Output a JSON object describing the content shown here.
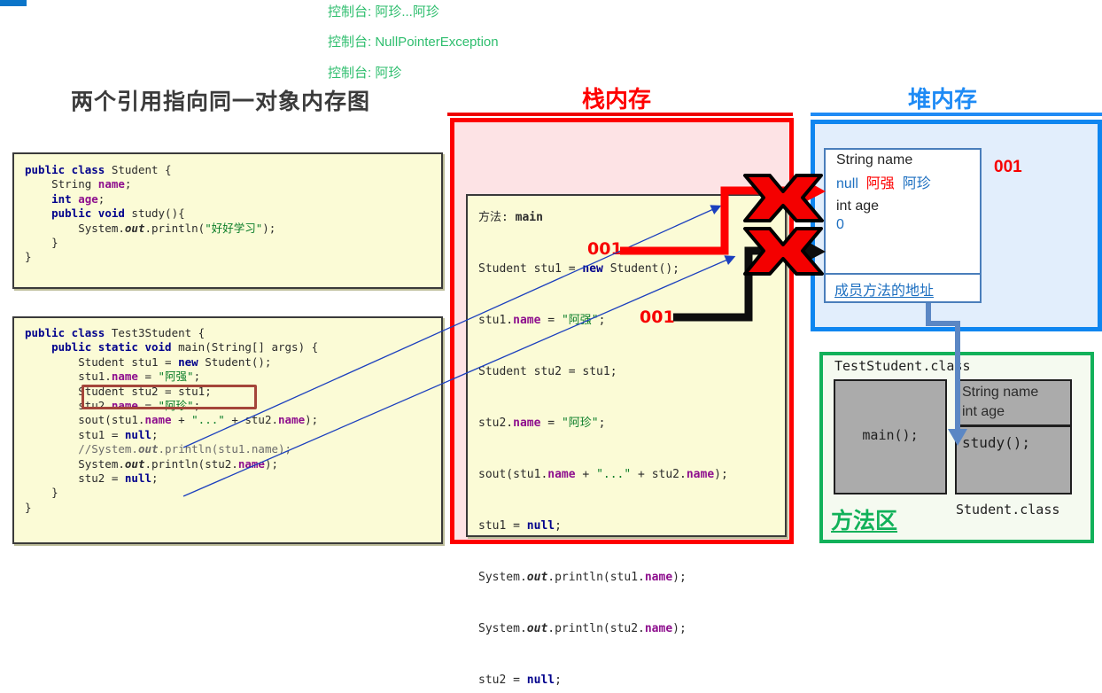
{
  "console": {
    "lines": [
      {
        "label": "控制台:",
        "value": "阿珍...阿珍"
      },
      {
        "label": "控制台:",
        "value": "NullPointerException"
      },
      {
        "label": "控制台:",
        "value": "阿珍"
      }
    ]
  },
  "titles": {
    "main": "两个引用指向同一对象内存图",
    "stack": "栈内存",
    "heap": "堆内存",
    "method_area": "方法区"
  },
  "code_student": {
    "lines": [
      "public class Student {",
      "    String name;",
      "    int age;",
      "    public void study(){",
      "        System.out.println(\"好好学习\");",
      "    }",
      "}"
    ]
  },
  "code_test": {
    "lines": [
      "public class Test3Student {",
      "    public static void main(String[] args) {",
      "        Student stu1 = new Student();",
      "        stu1.name = \"阿强\";",
      "        Student stu2 = stu1;",
      "        stu2.name = \"阿珍\";",
      "        sout(stu1.name + \"...\" + stu2.name);",
      "        stu1 = null;",
      "        //System.out.println(stu1.name);",
      "        System.out.println(stu2.name);",
      "        stu2 = null;",
      "    }",
      "}"
    ],
    "highlighted_line": "Student stu2 = stu1;"
  },
  "stack": {
    "method_label": "方法:",
    "method_name": "main",
    "lines": [
      "Student stu1 = new Student();",
      "stu1.name = \"阿强\";",
      "Student stu2 = stu1;",
      "stu2.name = \"阿珍\";",
      "sout(stu1.name + \"...\" + stu2.name);",
      "stu1 = null;",
      "System.out.println(stu1.name);",
      "System.out.println(stu2.name);",
      "stu2 = null;"
    ],
    "addr_stu1": "001",
    "addr_stu2": "001"
  },
  "heap": {
    "address": "001",
    "object": {
      "field_name_decl": "String name",
      "name_values": [
        "null",
        "阿强",
        "阿珍"
      ],
      "field_age_decl": "int age",
      "age_value": "0"
    },
    "method_address_label": "成员方法的地址"
  },
  "method_area": {
    "test_class_label": "TestStudent.class",
    "main_method": "main();",
    "student_fields": [
      "String name",
      "int age"
    ],
    "student_method": "study();",
    "student_class_label": "Student.class"
  },
  "colors": {
    "stack_border": "#FE0000",
    "stack_fill": "#FDE3E5",
    "heap_border": "#0F86F0",
    "heap_fill": "#E2EEFC",
    "method_area_border": "#12B15A",
    "console_green": "#2FBE6E",
    "address_red": "#F70000",
    "code_fill": "#FBFBD6"
  }
}
